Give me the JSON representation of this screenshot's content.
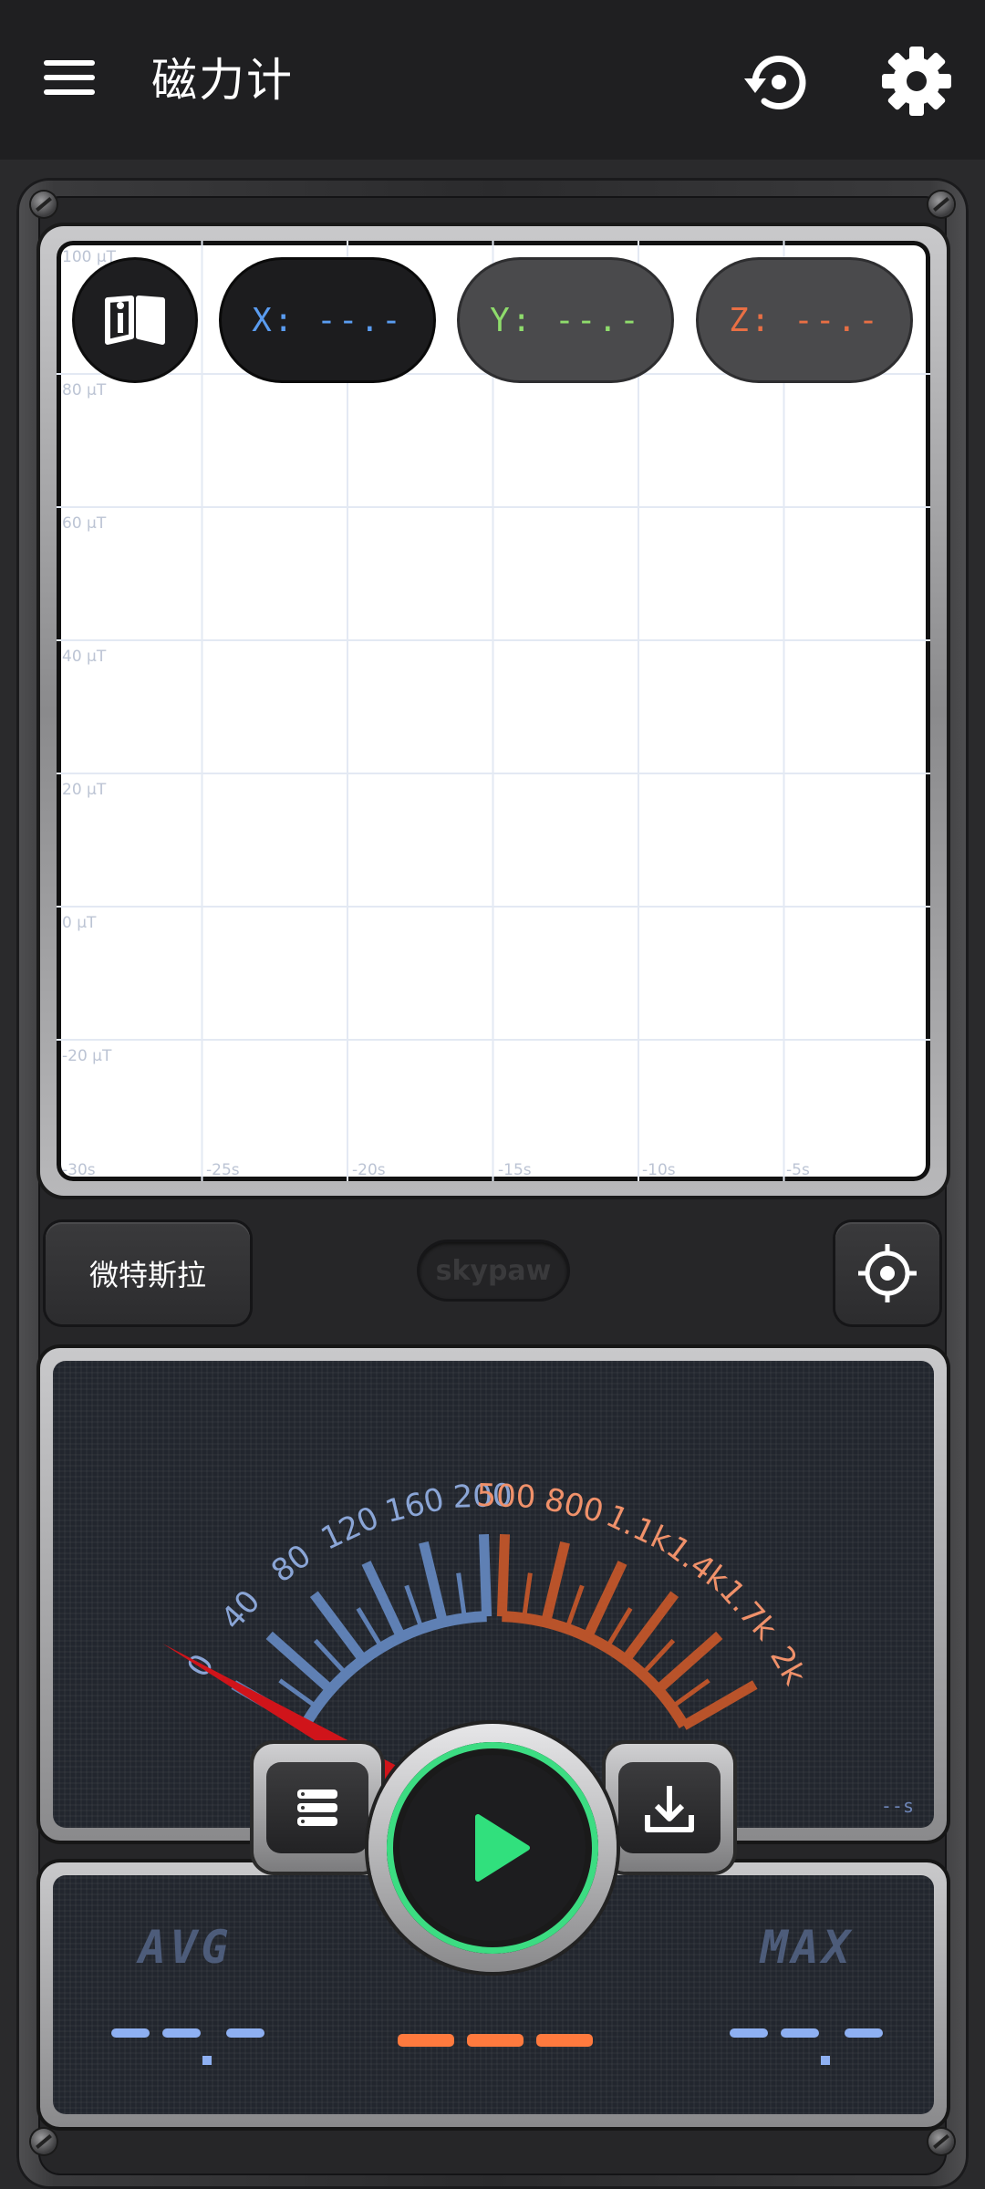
{
  "app": {
    "title": "磁力计"
  },
  "toolbar": {
    "menu_icon": "menu-icon",
    "restore_icon": "restore-icon",
    "settings_icon": "gear-icon"
  },
  "chart": {
    "y_ticks": [
      "100 μT",
      "80 μT",
      "60 μT",
      "40 μT",
      "20 μT",
      "0 μT",
      "-20 μT"
    ],
    "x_ticks": [
      "-30s",
      "-25s",
      "-20s",
      "-15s",
      "-10s",
      "-5s"
    ],
    "guide_icon": "book-info-icon",
    "x_pill": "X: --.-",
    "y_pill": "Y: --.-",
    "z_pill": "Z: --.-",
    "colors": {
      "x": "#5a9cf0",
      "y": "#8fdc6c",
      "z": "#e86f44"
    }
  },
  "chart_data": {
    "type": "line",
    "x": [],
    "series": [],
    "ylim": [
      -30,
      100
    ],
    "xlim": [
      -30,
      0
    ],
    "grid": true,
    "xlabel": "",
    "ylabel": ""
  },
  "controls": {
    "unit_label": "微特斯拉",
    "logo_text": "skypaw",
    "target_icon": "crosshair-icon"
  },
  "gauge": {
    "low_scale": [
      "0",
      "40",
      "80",
      "120",
      "160",
      "200"
    ],
    "high_scale": [
      "500",
      "800",
      "1.1k",
      "1.4k",
      "1.7k",
      "2k"
    ],
    "needle_value": 0,
    "time_label": "--s",
    "colors": {
      "low": "#5f80b4",
      "high": "#b9532a",
      "low_text": "#8aa5d6",
      "high_text": "#f0916a",
      "needle": "#d0141a"
    }
  },
  "stats": {
    "avg_label": "AVG",
    "max_label": "MAX"
  },
  "buttons": {
    "list_icon": "list-icon",
    "play_icon": "play-icon",
    "download_icon": "download-icon"
  }
}
